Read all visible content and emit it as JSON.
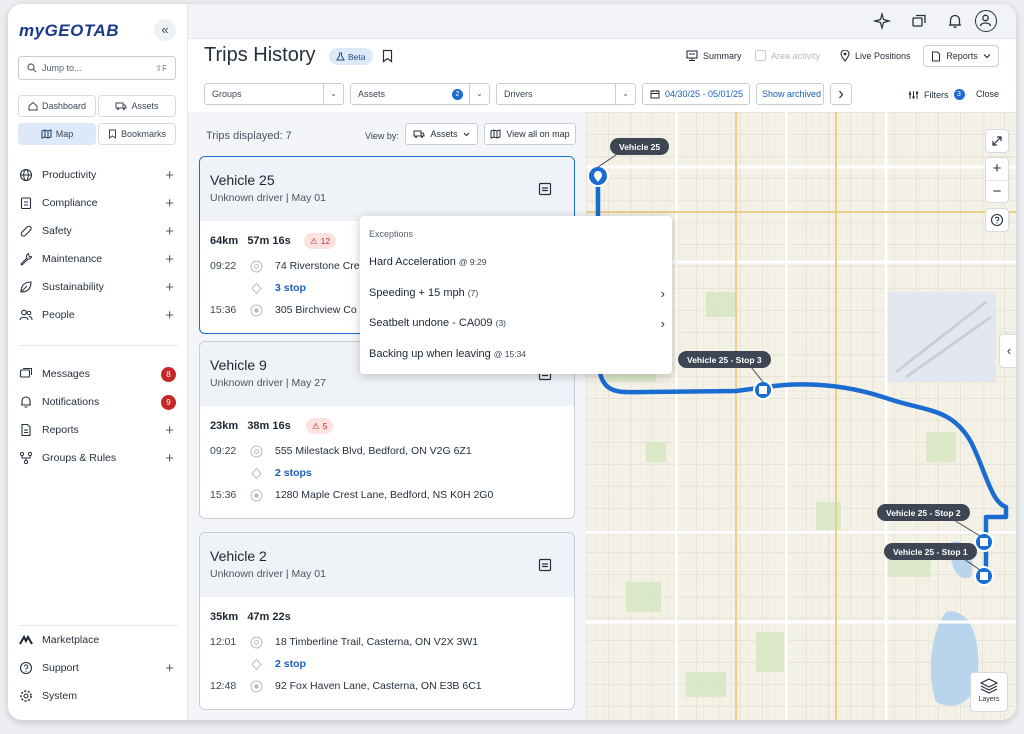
{
  "brand": {
    "logo": "myGEOTAB"
  },
  "sidebar": {
    "collapse_glyph": "«",
    "jump_placeholder": "Jump to...",
    "jump_shortcut": "⇧F",
    "quick": [
      {
        "label": "Dashboard",
        "icon": "home-icon"
      },
      {
        "label": "Assets",
        "icon": "truck-icon"
      },
      {
        "label": "Map",
        "icon": "map-icon",
        "selected": true
      },
      {
        "label": "Bookmarks",
        "icon": "bookmark-icon"
      }
    ],
    "groups": [
      {
        "label": "Productivity",
        "icon": "globe-icon"
      },
      {
        "label": "Compliance",
        "icon": "clipboard-icon"
      },
      {
        "label": "Safety",
        "icon": "bandage-icon"
      },
      {
        "label": "Maintenance",
        "icon": "wrench-icon"
      },
      {
        "label": "Sustainability",
        "icon": "leaf-icon"
      },
      {
        "label": "People",
        "icon": "people-icon"
      }
    ],
    "comms": [
      {
        "label": "Messages",
        "badge": "8",
        "icon": "messages-icon"
      },
      {
        "label": "Notifications",
        "badge": "9",
        "icon": "bell-icon"
      },
      {
        "label": "Reports",
        "icon": "document-icon"
      },
      {
        "label": "Groups & Rules",
        "icon": "hierarchy-icon"
      }
    ],
    "bottom": [
      {
        "label": "Marketplace",
        "icon": "marketplace-icon"
      },
      {
        "label": "Support",
        "icon": "help-circle-icon"
      },
      {
        "label": "System",
        "icon": "gear-icon"
      }
    ],
    "plus_glyph": "+"
  },
  "header": {
    "title": "Trips History",
    "beta_label": "Beta",
    "summary_label": "Summary",
    "area_activity_label": "Area activity",
    "live_positions_label": "Live Positions",
    "reports_label": "Reports"
  },
  "filters": {
    "groups_placeholder": "Groups",
    "assets_placeholder": "Assets",
    "assets_count": "2",
    "drivers_placeholder": "Drivers",
    "date_range": "04/30/25 - 05/01/25",
    "show_archived_label": "Show archived",
    "filters_label": "Filters",
    "filters_count": "3",
    "close_label": "Close"
  },
  "list": {
    "trips_displayed": "Trips displayed: 7",
    "view_by_label": "View by:",
    "view_by_value": "Assets",
    "view_all_label": "View all on map",
    "trips": [
      {
        "vehicle": "Vehicle 25",
        "subtitle": "Unknown driver | May 01",
        "distance": "64km",
        "duration": "57m 16s",
        "exceptions": "12",
        "start_time": "09:22",
        "start_address": "74 Riverstone Cre",
        "stops": "3 stop",
        "end_time": "15:36",
        "end_address": "305 Birchview Co"
      },
      {
        "vehicle": "Vehicle 9",
        "subtitle": "Unknown driver | May 27",
        "distance": "23km",
        "duration": "38m 16s",
        "exceptions": "5",
        "start_time": "09:22",
        "start_address": "555 Milestack Blvd, Bedford, ON V2G 6Z1",
        "stops": "2 stops",
        "end_time": "15:36",
        "end_address": "1280 Maple Crest Lane, Bedford, NS K0H 2G0"
      },
      {
        "vehicle": "Vehicle 2",
        "subtitle": "Unknown driver | May 01",
        "distance": "35km",
        "duration": "47m 22s",
        "start_time": "12:01",
        "start_address": "18 Timberline Trail, Casterna, ON V2X 3W1",
        "stops": "2 stop",
        "end_time": "12:48",
        "end_address": "92 Fox Haven Lane, Casterna, ON E3B 6C1"
      }
    ]
  },
  "exceptions_popup": {
    "header": "Exceptions",
    "items": [
      {
        "label": "Hard Acceleration",
        "detail": "@ 9:29"
      },
      {
        "label": "Speeding + 15 mph",
        "detail": "(7)",
        "arrow": "›"
      },
      {
        "label": "Seatbelt undone - CA009",
        "detail": "(3)",
        "arrow": "›"
      },
      {
        "label": "Backing up when leaving",
        "detail": "@ 15:34"
      }
    ]
  },
  "map": {
    "labels": [
      "Vehicle 25",
      "Vehicle 25 - Stop 3",
      "Vehicle 25 - Stop 2",
      "Vehicle 25 - Stop 1"
    ],
    "zoom_in": "+",
    "zoom_out": "−",
    "layers_label": "Layers",
    "route_color": "#1a6cd1",
    "collapse_glyph": "‹"
  },
  "colors": {
    "accent": "#1a6cd1",
    "danger": "#c62828",
    "beta_bg": "#dde9f8"
  }
}
